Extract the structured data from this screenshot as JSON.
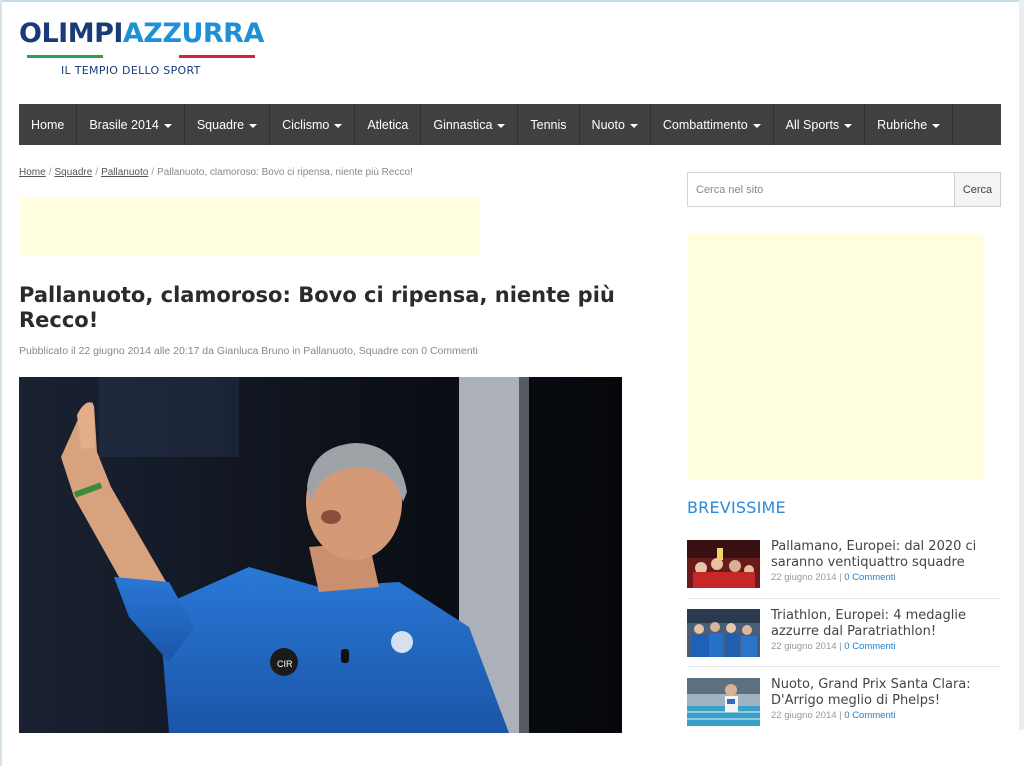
{
  "site": {
    "logo_part1": "OLIMPI",
    "logo_part2": "AZZURRA",
    "tagline": "IL TEMPIO DELLO SPORT"
  },
  "nav": {
    "items": [
      {
        "label": "Home",
        "dropdown": false
      },
      {
        "label": "Brasile 2014",
        "dropdown": true
      },
      {
        "label": "Squadre",
        "dropdown": true
      },
      {
        "label": "Ciclismo",
        "dropdown": true
      },
      {
        "label": "Atletica",
        "dropdown": false
      },
      {
        "label": "Ginnastica",
        "dropdown": true
      },
      {
        "label": "Tennis",
        "dropdown": false
      },
      {
        "label": "Nuoto",
        "dropdown": true
      },
      {
        "label": "Combattimento",
        "dropdown": true
      },
      {
        "label": "All Sports",
        "dropdown": true
      },
      {
        "label": "Rubriche",
        "dropdown": true
      }
    ]
  },
  "breadcrumb": {
    "home": "Home",
    "squadre": "Squadre",
    "pallanuoto": "Pallanuoto",
    "current": "Pallanuoto, clamoroso: Bovo ci ripensa, niente più Recco!",
    "separator": "/"
  },
  "article": {
    "title": "Pallanuoto, clamoroso: Bovo ci ripensa, niente più Recco!",
    "meta": "Pubblicato il 22 giugno 2014 alle 20:17 da Gianluca Bruno in Pallanuoto, Squadre con 0 Commenti"
  },
  "search": {
    "placeholder": "Cerca nel sito",
    "button": "Cerca"
  },
  "sidebar": {
    "section_title": "BREVISSIME",
    "news": [
      {
        "title": "Pallamano, Europei: dal 2020 ci saranno ventiquattro squadre",
        "date": "22 giugno 2014",
        "comments": "0 Commenti"
      },
      {
        "title": "Triathlon, Europei: 4 medaglie azzurre dal Paratriathlon!",
        "date": "22 giugno 2014",
        "comments": "0 Commenti"
      },
      {
        "title": "Nuoto, Grand Prix Santa Clara: D'Arrigo meglio di Phelps!",
        "date": "22 giugno 2014",
        "comments": "0 Commenti"
      }
    ],
    "meta_separator": "|"
  },
  "colors": {
    "nav_bg": "#404040",
    "accent_blue": "#2a8ad8",
    "ad_bg": "#ffffe0"
  }
}
